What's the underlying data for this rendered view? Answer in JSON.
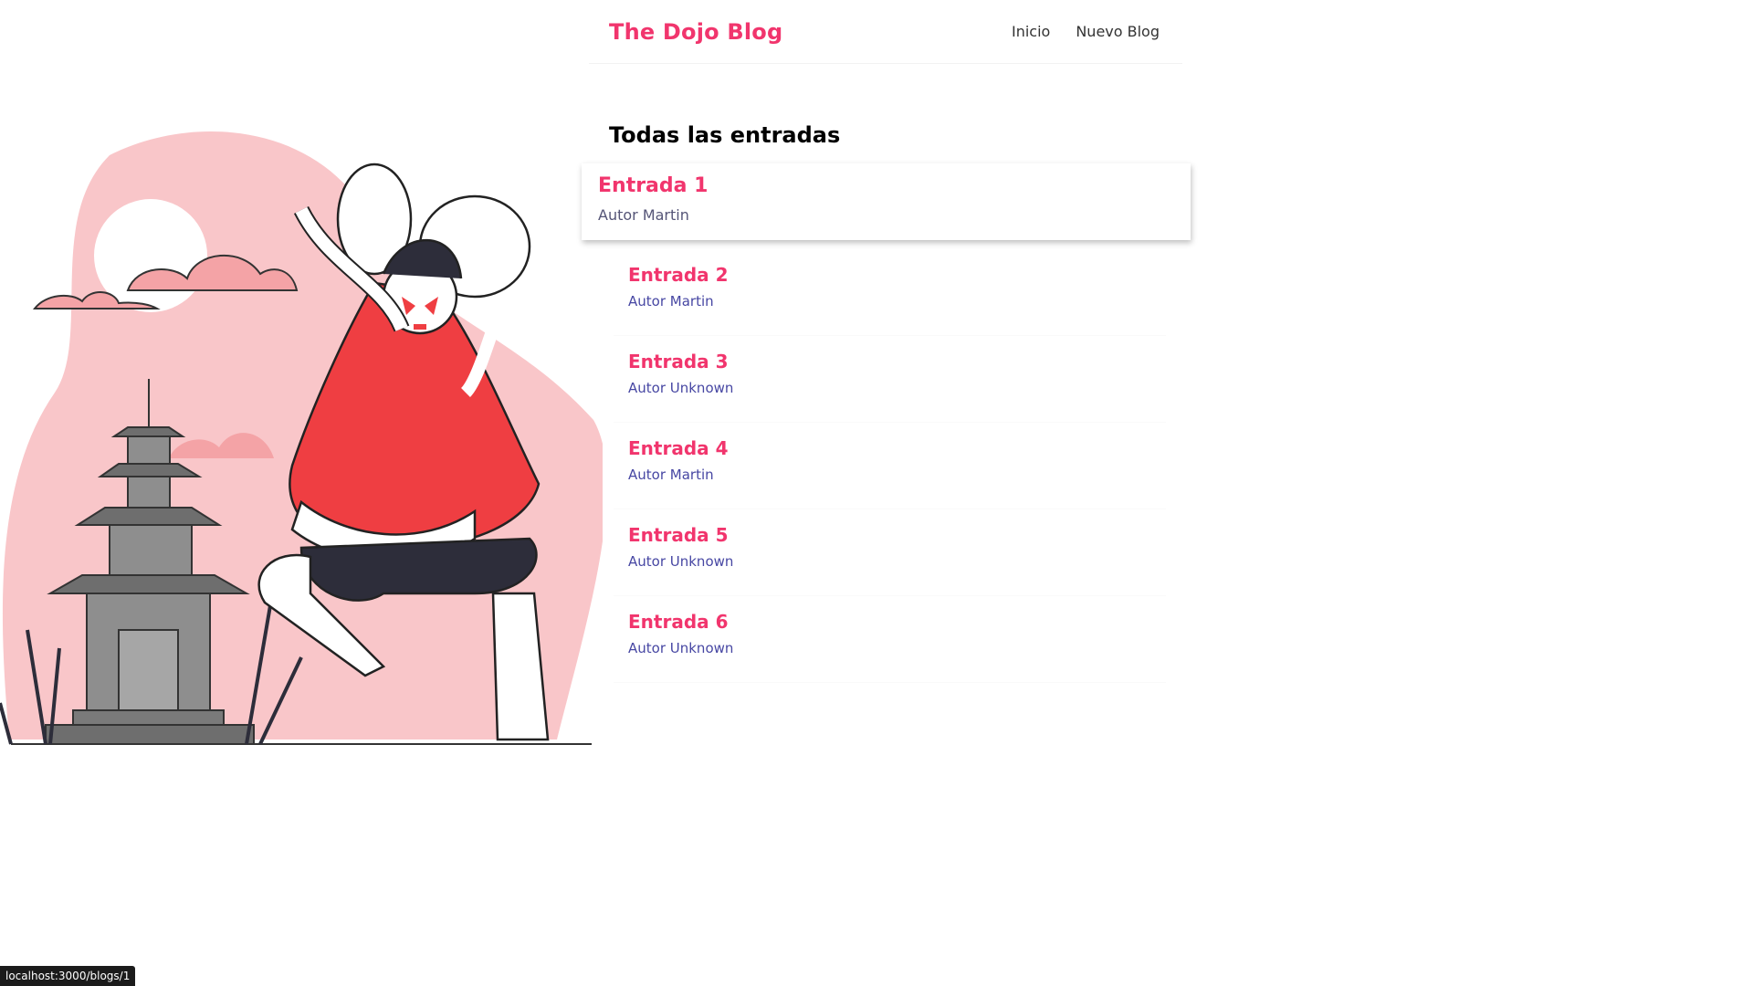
{
  "navbar": {
    "brand": "The Dojo Blog",
    "links": [
      "Inicio",
      "Nuevo Blog"
    ]
  },
  "page_title": "Todas las entradas",
  "blogs": [
    {
      "title": "Entrada 1",
      "author": "Autor Martin",
      "hovered": true
    },
    {
      "title": "Entrada 2",
      "author": "Autor Martin"
    },
    {
      "title": "Entrada 3",
      "author": "Autor Unknown"
    },
    {
      "title": "Entrada 4",
      "author": "Autor Martin"
    },
    {
      "title": "Entrada 5",
      "author": "Autor Unknown"
    },
    {
      "title": "Entrada 6",
      "author": "Autor Unknown"
    }
  ],
  "status_bar": {
    "url": "localhost:3000/blogs/1"
  },
  "colors": {
    "accent": "#f1356d",
    "author": "#4747a3",
    "illustration_bg": "#f9c6c9"
  },
  "illustration": {
    "subject": "kabuki-dancer-with-pagoda"
  }
}
